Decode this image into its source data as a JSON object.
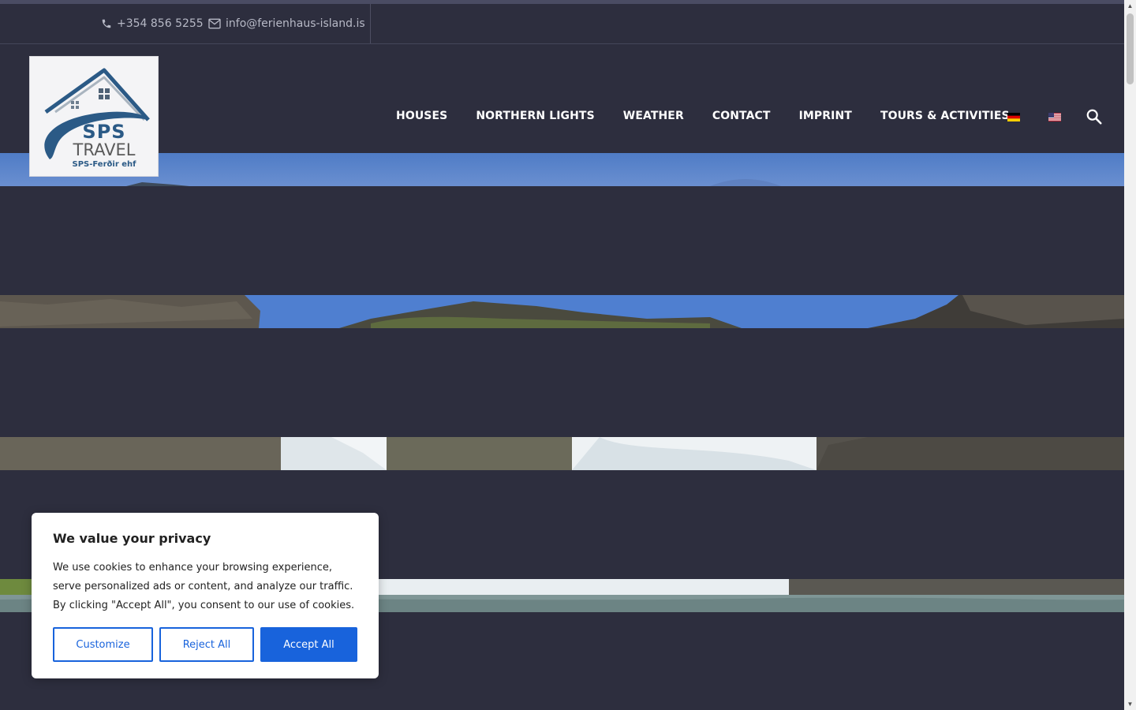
{
  "topbar": {
    "phone": "+354 856 5255",
    "email": "info@ferienhaus-island.is"
  },
  "logo": {
    "brand_line1": "SPS",
    "brand_line2": "TRAVEL",
    "company": "SPS-Ferðir ehf"
  },
  "nav": {
    "items": [
      {
        "label": "HOUSES"
      },
      {
        "label": "NORTHERN LIGHTS"
      },
      {
        "label": "WEATHER"
      },
      {
        "label": "CONTACT"
      },
      {
        "label": "IMPRINT"
      },
      {
        "label": "TOURS & ACTIVITIES"
      }
    ],
    "flags": [
      "german-flag-icon",
      "us-flag-icon"
    ],
    "search_icon": "search-icon"
  },
  "cookie_banner": {
    "title": "We value your privacy",
    "text": "We use cookies to enhance your browsing experience, serve personalized ads or content, and analyze our traffic. By clicking \"Accept All\", you consent to our use of cookies.",
    "customize_label": "Customize",
    "reject_label": "Reject All",
    "accept_label": "Accept All"
  },
  "colors": {
    "background": "#2d2e3e",
    "accent_blue": "#1863dc",
    "logo_blue": "#2b5a86"
  }
}
